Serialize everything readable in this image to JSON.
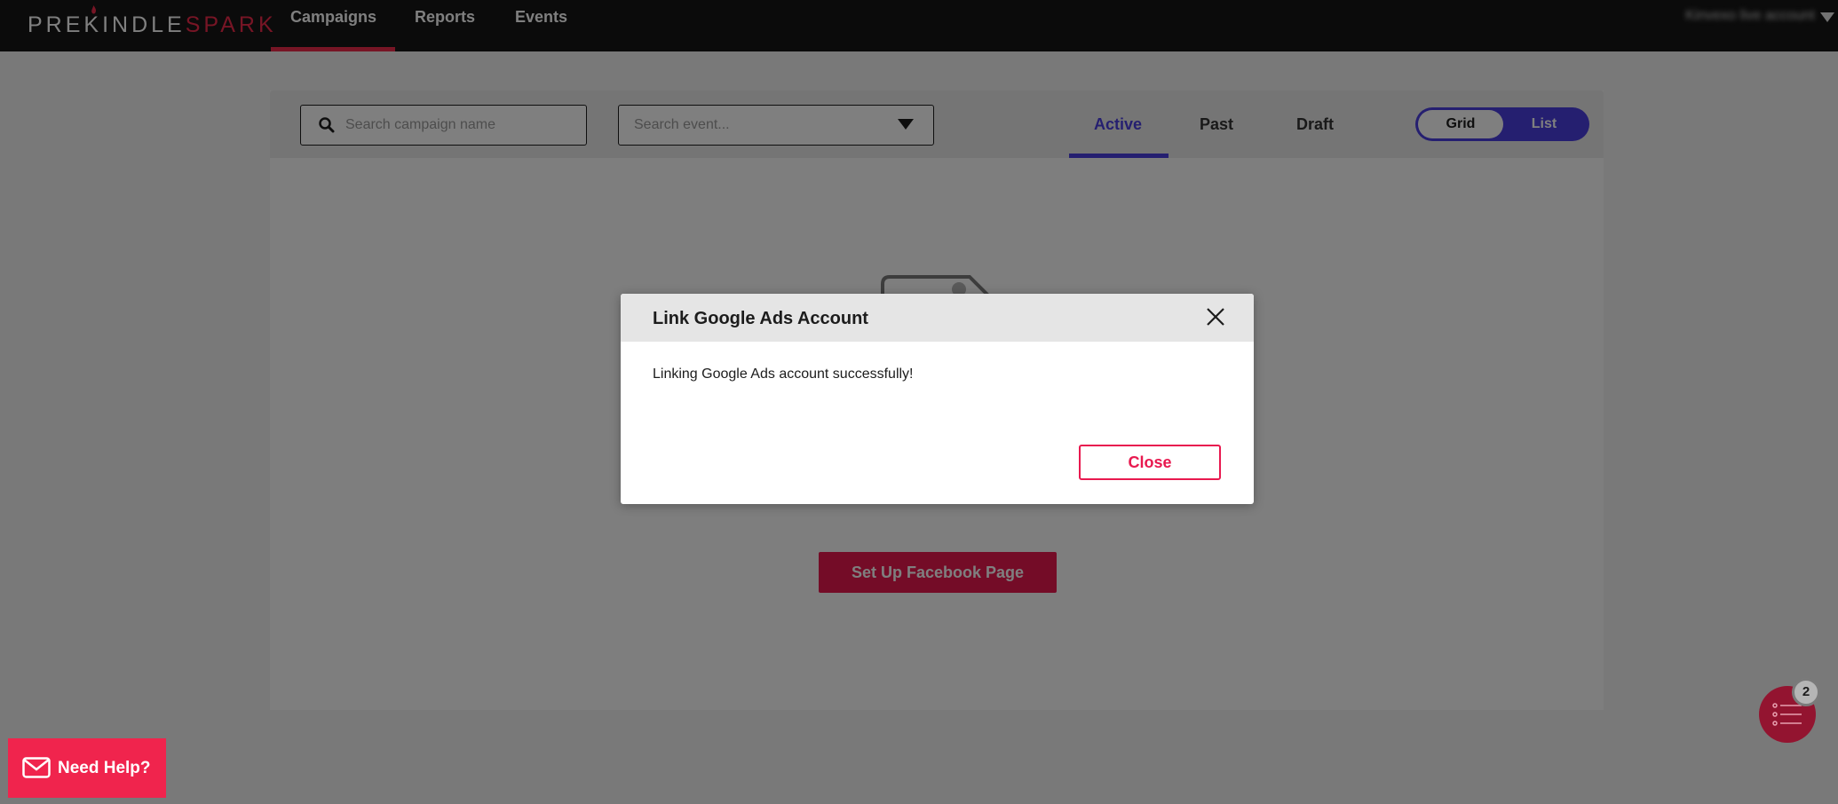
{
  "nav": {
    "logo_left": "PREKINDLE",
    "logo_right": "SPARK",
    "links": [
      {
        "label": "Campaigns"
      },
      {
        "label": "Reports"
      },
      {
        "label": "Events"
      }
    ],
    "active_link": "Campaigns",
    "account_label": "Kinvexo live account"
  },
  "toolbar": {
    "campaign_search_placeholder": "Search campaign name",
    "campaign_search_value": "",
    "event_search_placeholder": "Search event...",
    "event_search_value": "",
    "tabs": [
      {
        "label": "Active"
      },
      {
        "label": "Past"
      },
      {
        "label": "Draft"
      }
    ],
    "active_tab": "Active",
    "view_toggle": {
      "grid_label": "Grid",
      "list_label": "List",
      "selected": "Grid"
    }
  },
  "empty_state": {
    "setup_button_label": "Set Up Facebook Page"
  },
  "modal": {
    "title": "Link Google Ads Account",
    "message": "Linking Google Ads account successfully!",
    "close_button_label": "Close"
  },
  "help": {
    "label": "Need Help?"
  },
  "checklist": {
    "badge_count": "2"
  },
  "colors": {
    "brand_red": "#e8194f",
    "accent_purple": "#4b3fe0",
    "nav_bg": "#161616"
  },
  "icons": [
    "flame-icon",
    "search-icon",
    "dropdown-caret-icon",
    "close-icon",
    "mail-icon",
    "checklist-icon",
    "account-caret-icon"
  ]
}
